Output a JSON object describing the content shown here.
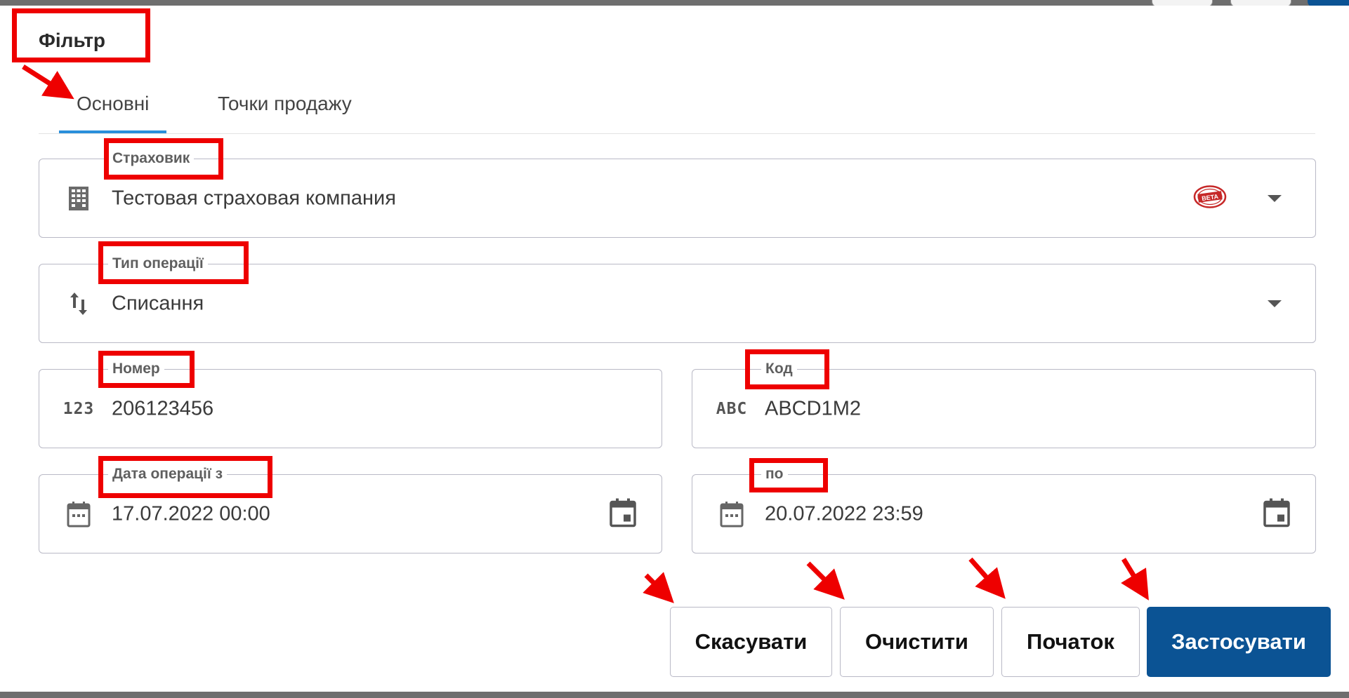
{
  "dialog": {
    "title": "Фільтр",
    "tabs": [
      {
        "label": "Основні",
        "active": true
      },
      {
        "label": "Точки продажу",
        "active": false
      }
    ]
  },
  "fields": {
    "insurer": {
      "label": "Страховик",
      "value": "Тестовая страховая компания",
      "icon": "building-icon",
      "badge": "BETA"
    },
    "operation_type": {
      "label": "Тип операції",
      "value": "Списання",
      "icon": "swap-vertical-icon"
    },
    "number": {
      "label": "Номер",
      "value": "206123456",
      "icon_text": "123"
    },
    "code": {
      "label": "Код",
      "value": "ABCD1M2",
      "icon_text": "ABC"
    },
    "date_from": {
      "label": "Дата операції з",
      "value": "17.07.2022 00:00",
      "icon": "calendar-icon"
    },
    "date_to": {
      "label": "по",
      "value": "20.07.2022 23:59",
      "icon": "calendar-icon"
    }
  },
  "buttons": {
    "cancel": "Скасувати",
    "clear": "Очистити",
    "reset": "Початок",
    "apply": "Застосувати"
  },
  "colors": {
    "accent": "#2a8fdb",
    "primary_button": "#0b5394",
    "annotation": "#ee0000"
  }
}
